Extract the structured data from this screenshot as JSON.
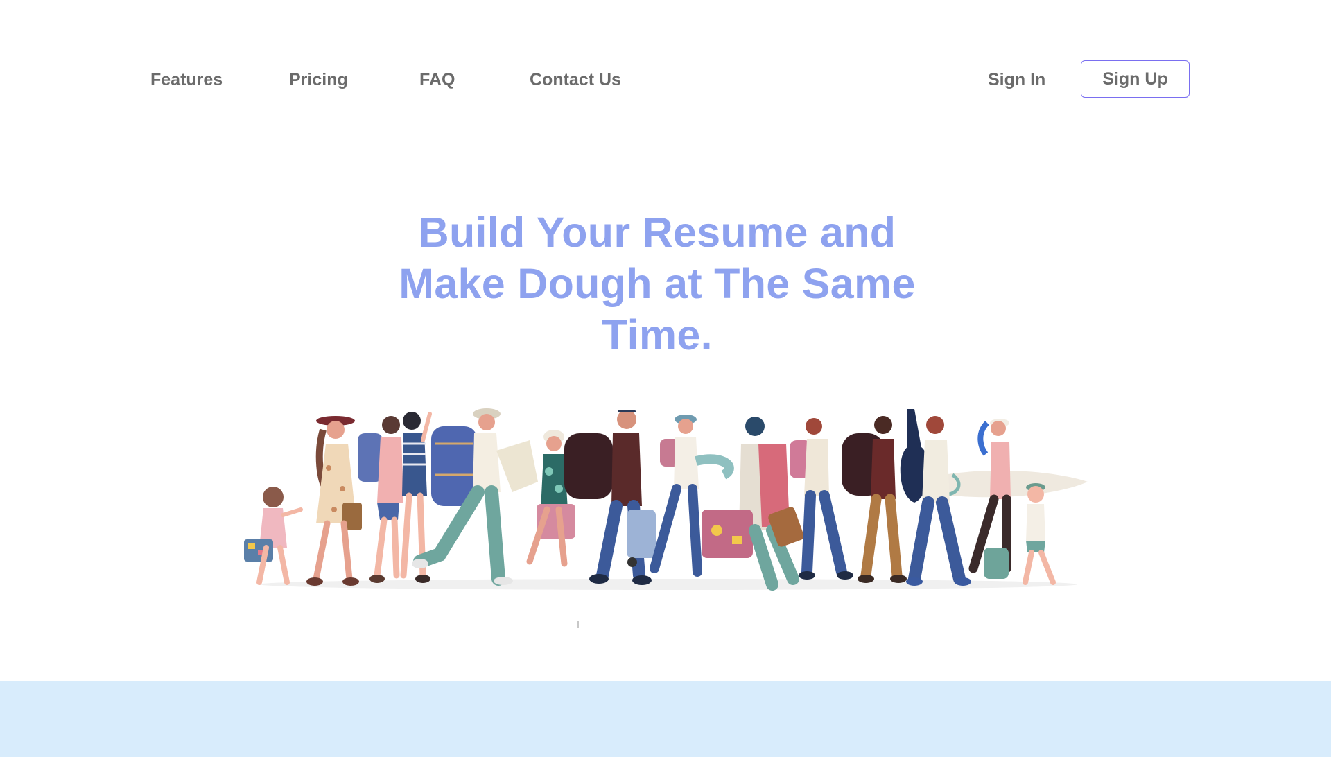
{
  "nav": {
    "links": [
      {
        "label": "Features"
      },
      {
        "label": "Pricing"
      },
      {
        "label": "FAQ"
      },
      {
        "label": "Contact Us"
      }
    ],
    "sign_in": "Sign In",
    "sign_up": "Sign Up"
  },
  "hero": {
    "title": "Build Your Resume and Make Dough at The Same Time.",
    "illustration": "travelers-crowd-illustration"
  },
  "colors": {
    "accent": "#8ea2ef",
    "button_border": "#7a6ff0",
    "nav_text": "#6b6b6b",
    "bottom_band": "#d8ecfc"
  }
}
